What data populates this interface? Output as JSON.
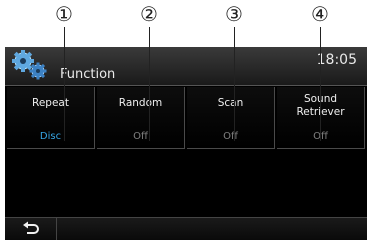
{
  "callouts": [
    "①",
    "②",
    "③",
    "④"
  ],
  "header": {
    "title": "Function",
    "clock": "18:05"
  },
  "buttons": [
    {
      "label": "Repeat",
      "value": "Disc"
    },
    {
      "label": "Random",
      "value": "Off"
    },
    {
      "label": "Scan",
      "value": "Off"
    },
    {
      "label": "Sound Retriever",
      "value": "Off"
    }
  ],
  "icons": {
    "header": "gear-icon",
    "back": "back-arrow-icon"
  },
  "colors": {
    "active_value": "#36a6e6",
    "inactive_value": "#808080",
    "text": "#f0f0f0"
  }
}
